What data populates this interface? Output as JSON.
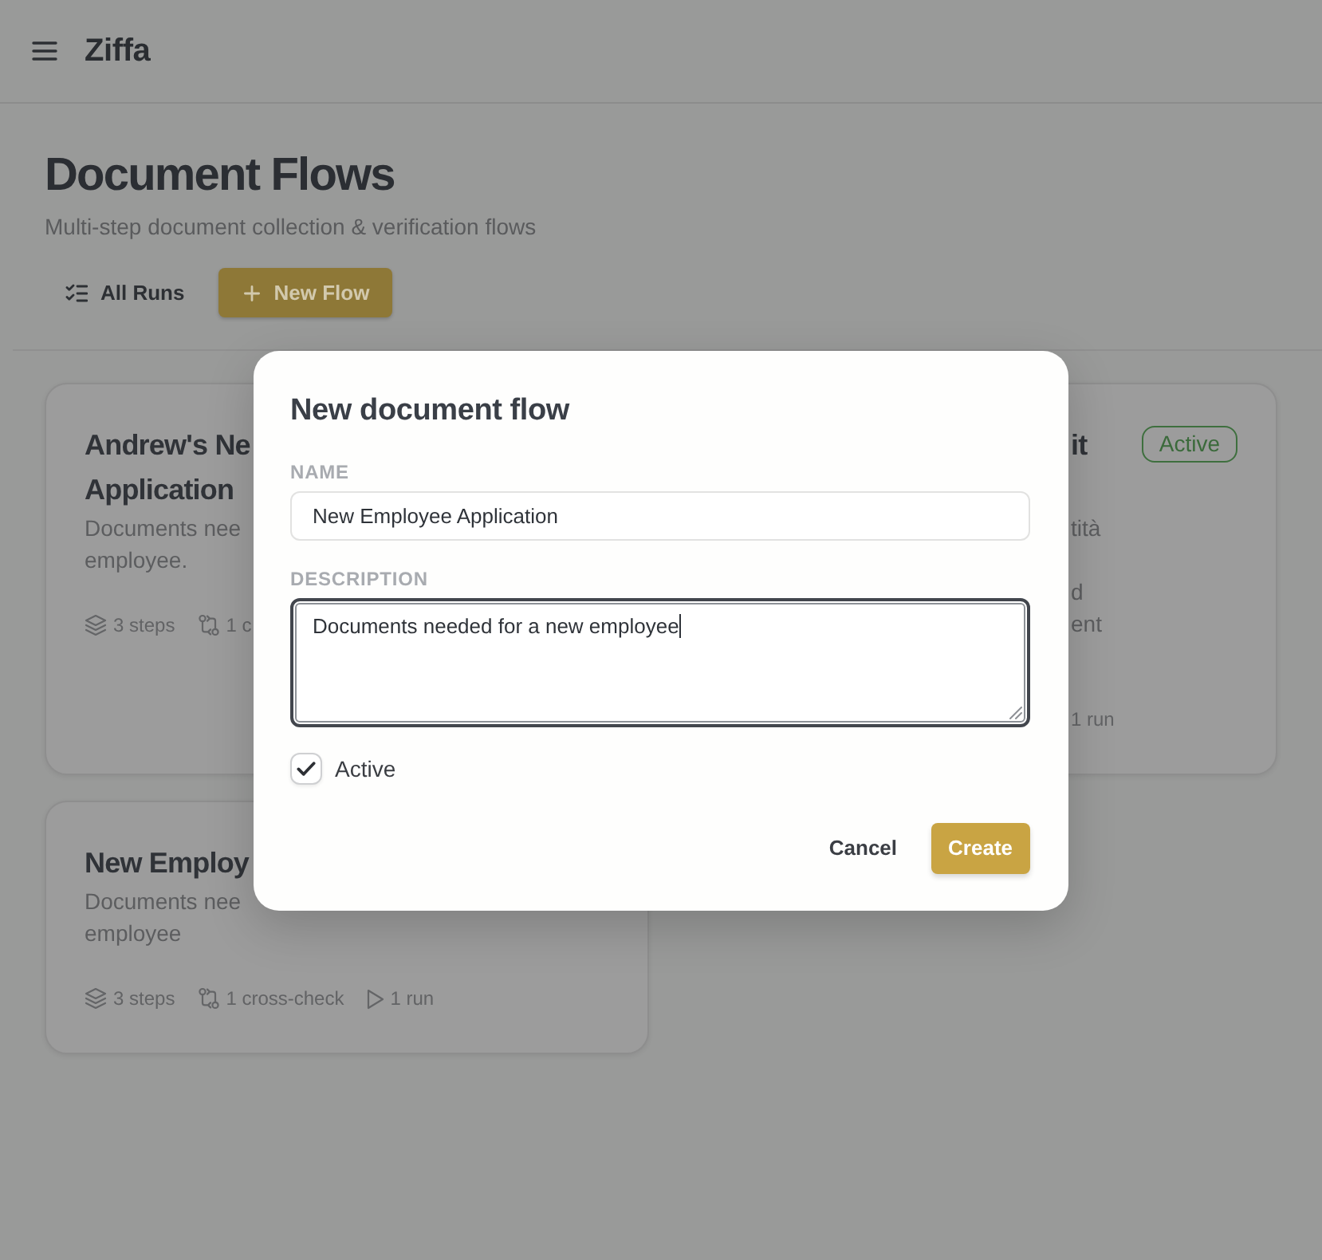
{
  "app": {
    "title": "Ziffa"
  },
  "page": {
    "title": "Document Flows",
    "subtitle": "Multi-step document collection & verification flows",
    "actions": [
      {
        "kind": "secondary",
        "label": "All Runs"
      },
      {
        "kind": "primary",
        "label": "New Flow"
      }
    ]
  },
  "flows": [
    {
      "title_lines": [
        "Andrew's Ne",
        "Application"
      ],
      "description_lines": [
        "Documents nee",
        "employee."
      ],
      "meta": [
        {
          "kind": "steps",
          "text": "3 steps"
        },
        {
          "kind": "cross_checks",
          "text": "1 c"
        }
      ]
    },
    {
      "title_lines": [
        "it"
      ],
      "status": {
        "kind": "active",
        "label": "Active"
      },
      "description_lines": [
        "tità",
        "d",
        "ent"
      ],
      "meta": [
        {
          "kind": "runs",
          "text": "1 run"
        }
      ]
    },
    {
      "title_lines": [
        "New Employ"
      ],
      "description_lines": [
        "Documents nee",
        "employee"
      ],
      "meta": [
        {
          "kind": "steps",
          "text": "3 steps"
        },
        {
          "kind": "cross_checks",
          "text": "1 cross-check"
        },
        {
          "kind": "runs",
          "text": "1 run"
        }
      ]
    }
  ],
  "dialog": {
    "title": "New document flow",
    "fields": [
      {
        "kind": "text",
        "label": "NAME",
        "value": "New Employee Application",
        "focused": false
      },
      {
        "kind": "textarea",
        "label": "DESCRIPTION",
        "value": "Documents needed for a new employee",
        "focused": true
      }
    ],
    "checkbox": {
      "label": "Active",
      "checked": true
    },
    "buttons": [
      {
        "kind": "secondary",
        "label": "Cancel"
      },
      {
        "kind": "primary",
        "label": "Create"
      }
    ]
  }
}
